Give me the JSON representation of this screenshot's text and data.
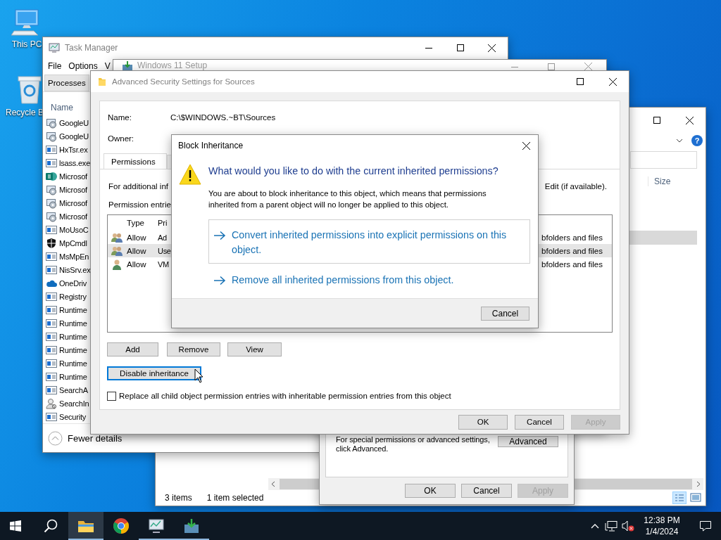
{
  "desktop_icons": [
    {
      "kind": "computer",
      "label": "This PC"
    },
    {
      "kind": "recycle_bin",
      "label": "Recycle B"
    }
  ],
  "explorer": {
    "help": "?",
    "column": "Size",
    "rows": [
      {
        "selected": true
      }
    ],
    "status": [
      "3 items",
      "1 item selected"
    ]
  },
  "properties_dialog": {
    "lines": [
      "For special permissions or advanced settings,",
      "click Advanced."
    ],
    "advanced_button": "Advanced",
    "buttons": [
      {
        "label": "OK",
        "disabled": false
      },
      {
        "label": "Cancel",
        "disabled": false
      },
      {
        "label": "Apply",
        "disabled": true
      }
    ]
  },
  "task_manager": {
    "title": "Task Manager",
    "menu": [
      "File",
      "Options",
      "V"
    ],
    "tabs": [
      {
        "label": "Processes",
        "selected": true
      }
    ],
    "column": "Name",
    "processes": [
      {
        "kind": "service",
        "name": "GoogleU"
      },
      {
        "kind": "service",
        "name": "GoogleU"
      },
      {
        "kind": "app",
        "name": "HxTsr.ex"
      },
      {
        "kind": "app",
        "name": "lsass.exe"
      },
      {
        "kind": "sharepoint",
        "name": "Microsof"
      },
      {
        "kind": "service",
        "name": "Microsof"
      },
      {
        "kind": "service",
        "name": "Microsof"
      },
      {
        "kind": "service",
        "name": "Microsof"
      },
      {
        "kind": "app",
        "name": "MoUsoC"
      },
      {
        "kind": "shield",
        "name": "MpCmdl"
      },
      {
        "kind": "app",
        "name": "MsMpEn"
      },
      {
        "kind": "app",
        "name": "NisSrv.ex"
      },
      {
        "kind": "cloud",
        "name": "OneDriv"
      },
      {
        "kind": "app",
        "name": "Registry"
      },
      {
        "kind": "app",
        "name": "Runtime"
      },
      {
        "kind": "app",
        "name": "Runtime"
      },
      {
        "kind": "app",
        "name": "Runtime"
      },
      {
        "kind": "app",
        "name": "Runtime"
      },
      {
        "kind": "app",
        "name": "Runtime"
      },
      {
        "kind": "app",
        "name": "Runtime"
      },
      {
        "kind": "app",
        "name": "SearchA"
      },
      {
        "kind": "user",
        "name": "SearchIn"
      },
      {
        "kind": "app",
        "name": "Security"
      }
    ],
    "footer": "Fewer details"
  },
  "setup_window": {
    "title": "Windows 11 Setup"
  },
  "advanced_security": {
    "title": "Advanced Security Settings for Sources",
    "name_label": "Name:",
    "name_value": "C:\\$WINDOWS.~BT\\Sources",
    "owner_label": "Owner:",
    "tabs": [
      {
        "label": "Permissions",
        "selected": true
      }
    ],
    "info_left": "For additional inf",
    "info_right": "Edit (if available).",
    "entries_label": "Permission entrie",
    "columns": [
      "Type",
      "Pri"
    ],
    "entries": [
      {
        "kind": "group",
        "type": "Allow",
        "principal": "Ad",
        "applies_to": "bfolders and files",
        "selected": false
      },
      {
        "kind": "group",
        "type": "Allow",
        "principal": "Use",
        "applies_to": "bfolders and files",
        "selected": true
      },
      {
        "kind": "user",
        "type": "Allow",
        "principal": "VM",
        "applies_to": "bfolders and files",
        "selected": false
      }
    ],
    "entry_buttons": [
      "Add",
      "Remove",
      "View"
    ],
    "inheritance_button": {
      "label": "Disable inheritance",
      "focused": true
    },
    "replace_checkbox": {
      "label": "Replace all child object permission entries with inheritable permission entries from this object",
      "checked": false
    },
    "buttons": [
      {
        "label": "OK",
        "disabled": false
      },
      {
        "label": "Cancel",
        "disabled": false
      },
      {
        "label": "Apply",
        "disabled": true
      }
    ]
  },
  "block_dialog": {
    "title": "Block Inheritance",
    "heading": "What would you like to do with the current inherited permissions?",
    "body": "You are about to block inheritance to this object, which means that permissions inherited from a parent object will no longer be applied to this object.",
    "options": [
      {
        "label": "Convert inherited permissions into explicit permissions on this object.",
        "highlighted": true
      },
      {
        "label": "Remove all inherited permissions from this object.",
        "highlighted": false
      }
    ],
    "cancel": "Cancel"
  },
  "taskbar": {
    "apps": [
      {
        "kind": "explorer",
        "active": true,
        "running": true
      },
      {
        "kind": "browser",
        "active": false,
        "running": false
      },
      {
        "kind": "task_manager",
        "active": false,
        "running": true
      },
      {
        "kind": "setup",
        "active": false,
        "running": true
      }
    ],
    "time": "12:38 PM",
    "date": "1/4/2024"
  }
}
